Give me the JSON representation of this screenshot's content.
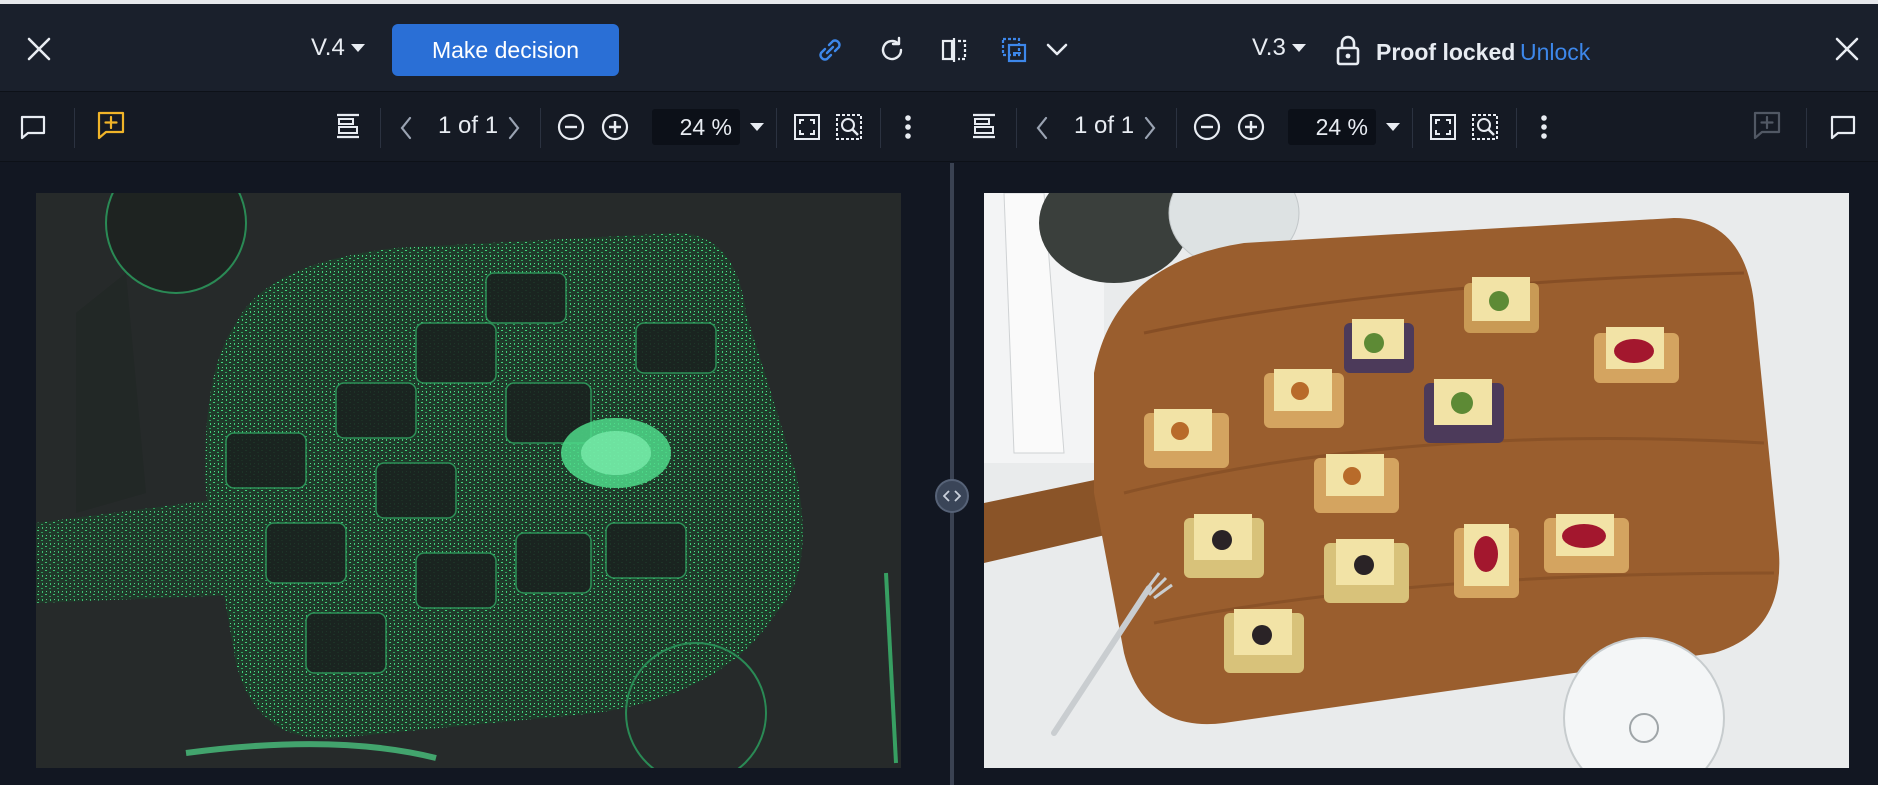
{
  "left_header": {
    "version_label": "V.4",
    "decision_button": "Make decision"
  },
  "right_header": {
    "version_label": "V.3",
    "lock_status": "Proof locked",
    "unlock_label": "Unlock"
  },
  "left_toolbar": {
    "page_indicator": "1 of 1",
    "zoom_value": "24 %"
  },
  "right_toolbar": {
    "page_indicator": "1 of 1",
    "zoom_value": "24 %"
  },
  "icons": {
    "close_left": "close-icon",
    "link": "link-icon",
    "refresh": "refresh-icon",
    "compare": "compare-split-icon",
    "overlay": "overlay-icon",
    "close_right": "close-icon"
  },
  "colors": {
    "accent": "#2a6fd6",
    "link_blue": "#3d87ea",
    "annotation_yellow": "#f0b429",
    "overlay_green": "#3fd17a"
  }
}
